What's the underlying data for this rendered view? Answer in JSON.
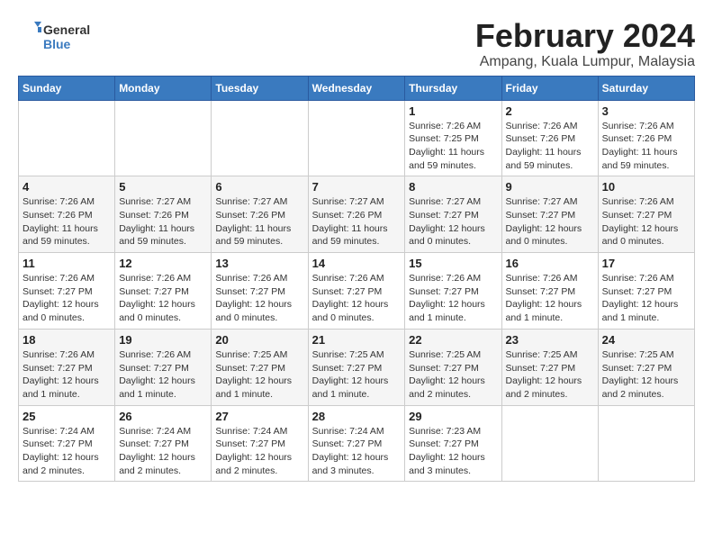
{
  "logo": {
    "line1": "General",
    "line2": "Blue"
  },
  "title": "February 2024",
  "subtitle": "Ampang, Kuala Lumpur, Malaysia",
  "days_of_week": [
    "Sunday",
    "Monday",
    "Tuesday",
    "Wednesday",
    "Thursday",
    "Friday",
    "Saturday"
  ],
  "weeks": [
    [
      {
        "day": "",
        "info": ""
      },
      {
        "day": "",
        "info": ""
      },
      {
        "day": "",
        "info": ""
      },
      {
        "day": "",
        "info": ""
      },
      {
        "day": "1",
        "info": "Sunrise: 7:26 AM\nSunset: 7:25 PM\nDaylight: 11 hours\nand 59 minutes."
      },
      {
        "day": "2",
        "info": "Sunrise: 7:26 AM\nSunset: 7:26 PM\nDaylight: 11 hours\nand 59 minutes."
      },
      {
        "day": "3",
        "info": "Sunrise: 7:26 AM\nSunset: 7:26 PM\nDaylight: 11 hours\nand 59 minutes."
      }
    ],
    [
      {
        "day": "4",
        "info": "Sunrise: 7:26 AM\nSunset: 7:26 PM\nDaylight: 11 hours\nand 59 minutes."
      },
      {
        "day": "5",
        "info": "Sunrise: 7:27 AM\nSunset: 7:26 PM\nDaylight: 11 hours\nand 59 minutes."
      },
      {
        "day": "6",
        "info": "Sunrise: 7:27 AM\nSunset: 7:26 PM\nDaylight: 11 hours\nand 59 minutes."
      },
      {
        "day": "7",
        "info": "Sunrise: 7:27 AM\nSunset: 7:26 PM\nDaylight: 11 hours\nand 59 minutes."
      },
      {
        "day": "8",
        "info": "Sunrise: 7:27 AM\nSunset: 7:27 PM\nDaylight: 12 hours\nand 0 minutes."
      },
      {
        "day": "9",
        "info": "Sunrise: 7:27 AM\nSunset: 7:27 PM\nDaylight: 12 hours\nand 0 minutes."
      },
      {
        "day": "10",
        "info": "Sunrise: 7:26 AM\nSunset: 7:27 PM\nDaylight: 12 hours\nand 0 minutes."
      }
    ],
    [
      {
        "day": "11",
        "info": "Sunrise: 7:26 AM\nSunset: 7:27 PM\nDaylight: 12 hours\nand 0 minutes."
      },
      {
        "day": "12",
        "info": "Sunrise: 7:26 AM\nSunset: 7:27 PM\nDaylight: 12 hours\nand 0 minutes."
      },
      {
        "day": "13",
        "info": "Sunrise: 7:26 AM\nSunset: 7:27 PM\nDaylight: 12 hours\nand 0 minutes."
      },
      {
        "day": "14",
        "info": "Sunrise: 7:26 AM\nSunset: 7:27 PM\nDaylight: 12 hours\nand 0 minutes."
      },
      {
        "day": "15",
        "info": "Sunrise: 7:26 AM\nSunset: 7:27 PM\nDaylight: 12 hours\nand 1 minute."
      },
      {
        "day": "16",
        "info": "Sunrise: 7:26 AM\nSunset: 7:27 PM\nDaylight: 12 hours\nand 1 minute."
      },
      {
        "day": "17",
        "info": "Sunrise: 7:26 AM\nSunset: 7:27 PM\nDaylight: 12 hours\nand 1 minute."
      }
    ],
    [
      {
        "day": "18",
        "info": "Sunrise: 7:26 AM\nSunset: 7:27 PM\nDaylight: 12 hours\nand 1 minute."
      },
      {
        "day": "19",
        "info": "Sunrise: 7:26 AM\nSunset: 7:27 PM\nDaylight: 12 hours\nand 1 minute."
      },
      {
        "day": "20",
        "info": "Sunrise: 7:25 AM\nSunset: 7:27 PM\nDaylight: 12 hours\nand 1 minute."
      },
      {
        "day": "21",
        "info": "Sunrise: 7:25 AM\nSunset: 7:27 PM\nDaylight: 12 hours\nand 1 minute."
      },
      {
        "day": "22",
        "info": "Sunrise: 7:25 AM\nSunset: 7:27 PM\nDaylight: 12 hours\nand 2 minutes."
      },
      {
        "day": "23",
        "info": "Sunrise: 7:25 AM\nSunset: 7:27 PM\nDaylight: 12 hours\nand 2 minutes."
      },
      {
        "day": "24",
        "info": "Sunrise: 7:25 AM\nSunset: 7:27 PM\nDaylight: 12 hours\nand 2 minutes."
      }
    ],
    [
      {
        "day": "25",
        "info": "Sunrise: 7:24 AM\nSunset: 7:27 PM\nDaylight: 12 hours\nand 2 minutes."
      },
      {
        "day": "26",
        "info": "Sunrise: 7:24 AM\nSunset: 7:27 PM\nDaylight: 12 hours\nand 2 minutes."
      },
      {
        "day": "27",
        "info": "Sunrise: 7:24 AM\nSunset: 7:27 PM\nDaylight: 12 hours\nand 2 minutes."
      },
      {
        "day": "28",
        "info": "Sunrise: 7:24 AM\nSunset: 7:27 PM\nDaylight: 12 hours\nand 3 minutes."
      },
      {
        "day": "29",
        "info": "Sunrise: 7:23 AM\nSunset: 7:27 PM\nDaylight: 12 hours\nand 3 minutes."
      },
      {
        "day": "",
        "info": ""
      },
      {
        "day": "",
        "info": ""
      }
    ]
  ]
}
